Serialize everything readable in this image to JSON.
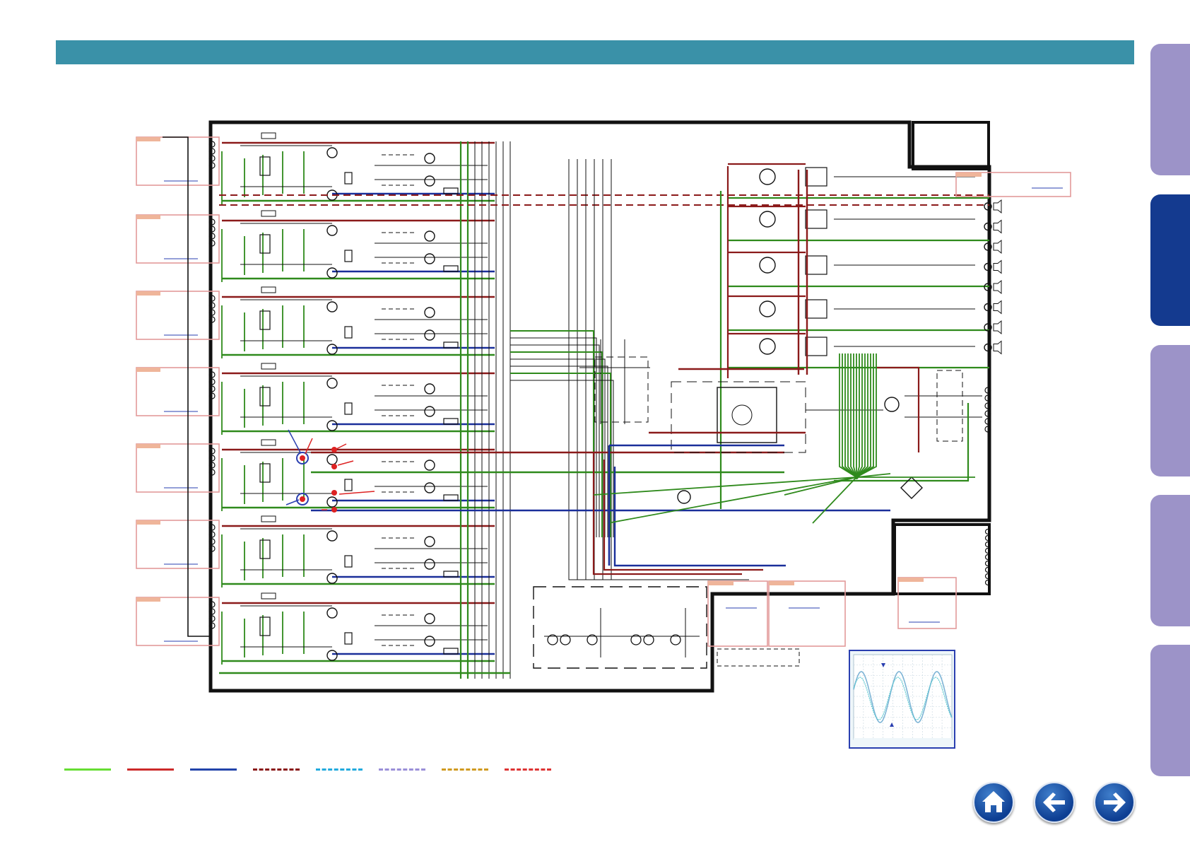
{
  "header": {
    "title": ""
  },
  "side_tabs": [
    {
      "name": "tab-1",
      "active": false,
      "color": "#9c93c8"
    },
    {
      "name": "tab-2",
      "active": true,
      "color": "#143a8f"
    },
    {
      "name": "tab-3",
      "active": false,
      "color": "#9c93c8"
    },
    {
      "name": "tab-4",
      "active": false,
      "color": "#9c93c8"
    },
    {
      "name": "tab-5",
      "active": false,
      "color": "#9c93c8"
    }
  ],
  "legend": [
    {
      "color": "#66dd33",
      "style": "solid"
    },
    {
      "color": "#cc2a2a",
      "style": "solid"
    },
    {
      "color": "#2244aa",
      "style": "solid"
    },
    {
      "color": "#8a1a1a",
      "style": "dashed"
    },
    {
      "color": "#22aadd",
      "style": "dashed"
    },
    {
      "color": "#9a8fd8",
      "style": "dashed"
    },
    {
      "color": "#d09a20",
      "style": "dashed"
    },
    {
      "color": "#dd3333",
      "style": "dashed"
    }
  ],
  "navigation": {
    "home": "home-icon",
    "back": "arrow-left-icon",
    "forward": "arrow-right-icon"
  },
  "colors": {
    "board_outline": "#111111",
    "trace_green": "#2f8a1c",
    "trace_red": "#8b1a1a",
    "trace_blue": "#1a2f9a",
    "connector_box": "#e39a9a",
    "scope_frame": "#2a3fb0"
  }
}
